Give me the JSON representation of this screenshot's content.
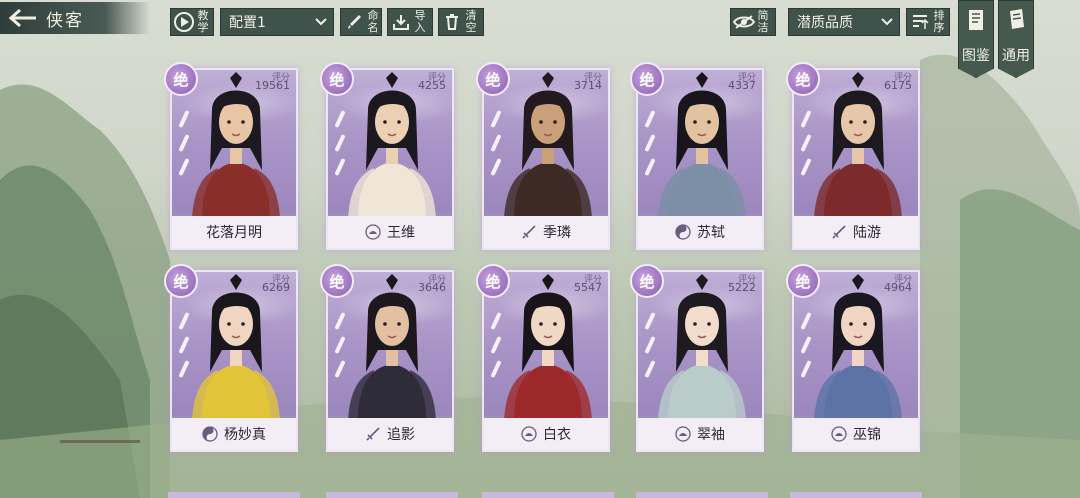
{
  "header": {
    "title": "侠客",
    "tutorial_label": "教学",
    "preset_select": "配置1",
    "rename_label": "命名",
    "import_label": "导入",
    "clear_label": "清空",
    "simple_label": "简洁",
    "quality_select": "潜质品质",
    "sort_label": "排序",
    "tab_gallery": "图鉴",
    "tab_common": "通用"
  },
  "score_label": "评分",
  "rank_label": "绝",
  "cards": [
    {
      "name": "花落月明",
      "score": "19561",
      "school_icon": "none"
    },
    {
      "name": "王维",
      "score": "4255",
      "school_icon": "lotus-icon"
    },
    {
      "name": "季璘",
      "score": "3714",
      "school_icon": "sword-icon"
    },
    {
      "name": "苏轼",
      "score": "4337",
      "school_icon": "taiji-icon"
    },
    {
      "name": "陆游",
      "score": "6175",
      "school_icon": "sword-icon"
    },
    {
      "name": "杨妙真",
      "score": "6269",
      "school_icon": "taiji-icon"
    },
    {
      "name": "追影",
      "score": "3646",
      "school_icon": "sword-icon"
    },
    {
      "name": "白衣",
      "score": "5547",
      "school_icon": "lotus-icon"
    },
    {
      "name": "翠袖",
      "score": "5222",
      "school_icon": "lotus-icon"
    },
    {
      "name": "巫锦",
      "score": "4964",
      "school_icon": "lotus-icon"
    }
  ],
  "colors": {
    "card_purple": "#9d8fba",
    "toolbar": "#3f524c",
    "badge": "#8a5fb2"
  }
}
